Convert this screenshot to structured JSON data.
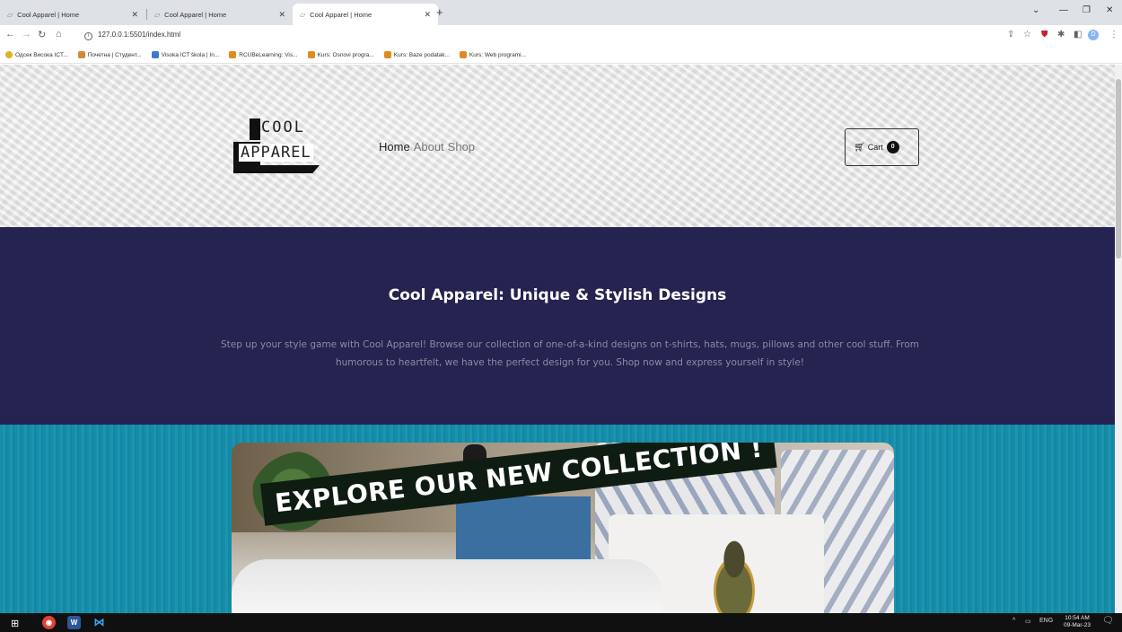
{
  "browser": {
    "tabs": [
      {
        "title": "Cool Apparel | Home",
        "close": "✕"
      },
      {
        "title": "Cool Apparel | Home",
        "close": "✕"
      },
      {
        "title": "Cool Apparel | Home",
        "close": "✕"
      }
    ],
    "new_tab": "+",
    "url": "127.0.0.1:5501/index.html",
    "profile_initial": "D",
    "bookmarks": [
      {
        "label": "Одсек Висока ICT...",
        "color": "#e0b020"
      },
      {
        "label": "Почетна | Студент...",
        "color": "#d08a3a"
      },
      {
        "label": "Visoka ICT škola | In...",
        "color": "#3a7ac8"
      },
      {
        "label": "RCUBeLearning: Vis...",
        "color": "#e08a20"
      },
      {
        "label": "Kurs: Osnovi progra...",
        "color": "#e08a20"
      },
      {
        "label": "Kurs: Baze podatak...",
        "color": "#e08a20"
      },
      {
        "label": "Kurs: Web programi...",
        "color": "#e08a20"
      }
    ]
  },
  "site": {
    "logo_top": "COOL",
    "logo_bottom": "APPAREL",
    "nav": [
      {
        "label": "Home"
      },
      {
        "label": "About"
      },
      {
        "label": "Shop"
      }
    ],
    "cart_label": "Cart",
    "cart_count": "0",
    "hero_title": "Cool Apparel: Unique & Stylish Designs",
    "hero_text": "Step up your style game with Cool Apparel! Browse our collection of one-of-a-kind designs on t-shirts, hats, mugs, pillows and other cool stuff. From humorous to heartfelt, we have the perfect design for you. Shop now and express yourself in style!",
    "banner_text": "EXPLORE OUR NEW COLLECTION !"
  },
  "taskbar": {
    "lang": "ENG",
    "time": "10:54 AM",
    "date": "09-Mar-23"
  },
  "colors": {
    "hero_bg": "#25234f",
    "collection_bg": "#178ba7",
    "banner_label_bg": "#0f1c12"
  }
}
